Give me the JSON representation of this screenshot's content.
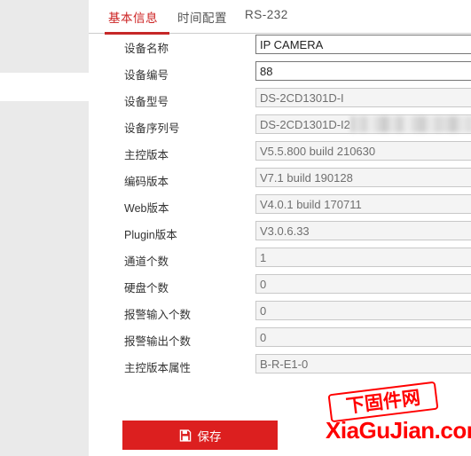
{
  "theme": {
    "accent": "#c62828",
    "button_red": "#dc1f1f",
    "rail_gray": "#eaeaea",
    "readonly_bg": "#f4f4f4",
    "watermark_red": "#ff0000"
  },
  "tabs": [
    {
      "label": "基本信息",
      "active": true
    },
    {
      "label": "时间配置",
      "active": false
    },
    {
      "label": "RS-232",
      "active": false
    }
  ],
  "form": {
    "fields": [
      {
        "label": "设备名称",
        "value": "IP CAMERA",
        "readonly": false,
        "redacted": false
      },
      {
        "label": "设备编号",
        "value": "88",
        "readonly": false,
        "redacted": false
      },
      {
        "label": "设备型号",
        "value": "DS-2CD1301D-I",
        "readonly": true,
        "redacted": false
      },
      {
        "label": "设备序列号",
        "value": "DS-2CD1301D-I2",
        "readonly": true,
        "redacted": true
      },
      {
        "label": "主控版本",
        "value": "V5.5.800 build 210630",
        "readonly": true,
        "redacted": false
      },
      {
        "label": "编码版本",
        "value": "V7.1 build 190128",
        "readonly": true,
        "redacted": false
      },
      {
        "label": "Web版本",
        "value": "V4.0.1 build 170711",
        "readonly": true,
        "redacted": false
      },
      {
        "label": "Plugin版本",
        "value": "V3.0.6.33",
        "readonly": true,
        "redacted": false
      },
      {
        "label": "通道个数",
        "value": "1",
        "readonly": true,
        "redacted": false
      },
      {
        "label": "硬盘个数",
        "value": "0",
        "readonly": true,
        "redacted": false
      },
      {
        "label": "报警输入个数",
        "value": "0",
        "readonly": true,
        "redacted": false
      },
      {
        "label": "报警输出个数",
        "value": "0",
        "readonly": true,
        "redacted": false
      },
      {
        "label": "主控版本属性",
        "value": "B-R-E1-0",
        "readonly": true,
        "redacted": false
      }
    ]
  },
  "actions": {
    "save_label": "保存",
    "save_icon": "floppy-disk-icon"
  },
  "watermark": {
    "top_text": "下固件网",
    "bottom_text": "XiaGuJian.com"
  }
}
